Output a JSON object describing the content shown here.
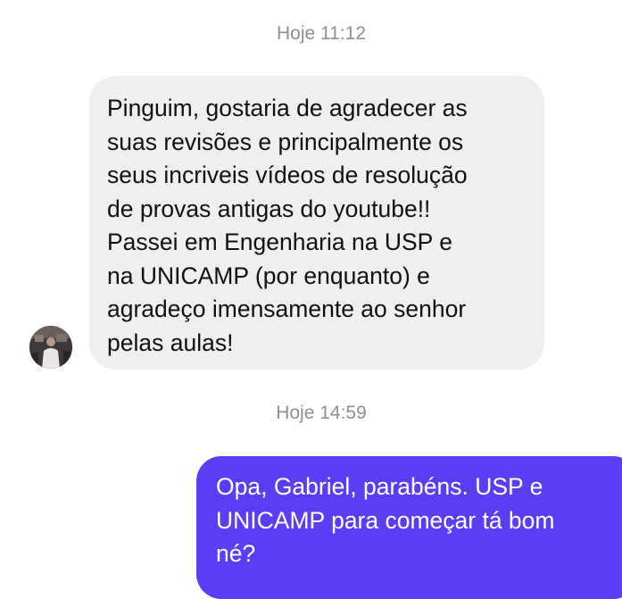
{
  "conversation": {
    "messages": [
      {
        "timestamp": "Hoje 11:12",
        "direction": "incoming",
        "text": "Pinguim, gostaria de agradecer as\nsuas revisões e principalmente os\nseus incriveis vídeos de resolução\nde provas antigas do youtube!!\nPassei em Engenharia na USP e\nna UNICAMP (por enquanto) e\nagradeço imensamente ao senhor\npelas aulas!"
      },
      {
        "timestamp": "Hoje 14:59",
        "direction": "outgoing",
        "text": "Opa, Gabriel, parabéns. USP e\nUNICAMP para começar tá bom\nné?"
      }
    ]
  },
  "colors": {
    "incoming_bubble": "#efefef",
    "outgoing_bubble": "#5b3df5",
    "timestamp": "#8e8e93"
  }
}
